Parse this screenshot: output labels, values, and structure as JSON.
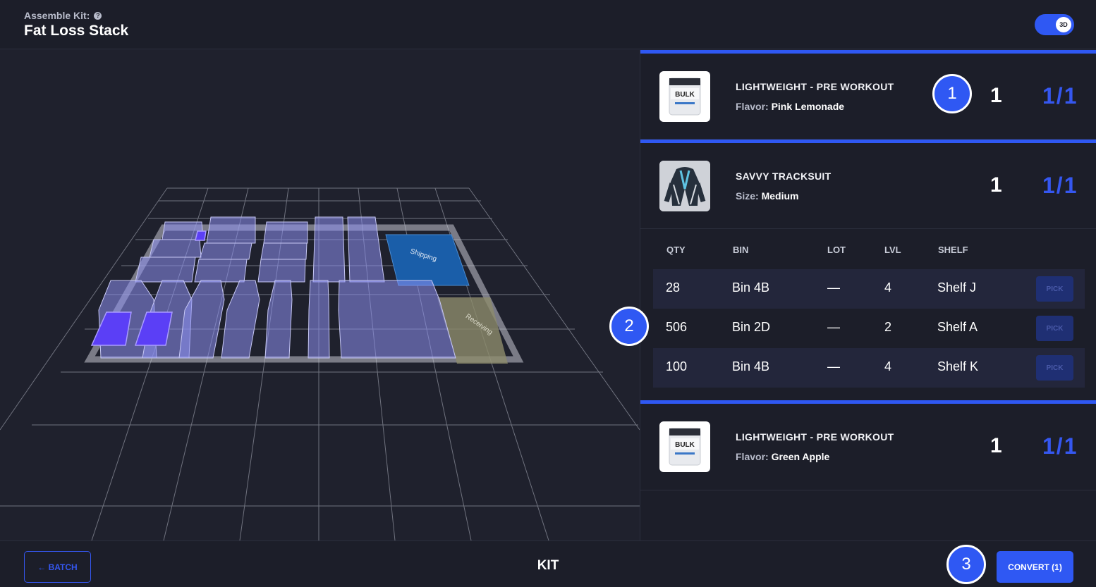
{
  "header": {
    "subtitle": "Assemble Kit:",
    "title": "Fat Loss Stack",
    "toggle_label": "3D"
  },
  "scene": {
    "zones": [
      "Shipping",
      "Receiving"
    ]
  },
  "items": [
    {
      "name": "LIGHTWEIGHT - PRE WORKOUT",
      "attr_key": "Flavor:",
      "attr_value": "Pink Lemonade",
      "qty": "1",
      "progress": "1/1",
      "thumb_label": "BULK"
    },
    {
      "name": "SAVVY TRACKSUIT",
      "attr_key": "Size:",
      "attr_value": "Medium",
      "qty": "1",
      "progress": "1/1"
    },
    {
      "name": "LIGHTWEIGHT - PRE WORKOUT",
      "attr_key": "Flavor:",
      "attr_value": "Green Apple",
      "qty": "1",
      "progress": "1/1",
      "thumb_label": "BULK"
    }
  ],
  "bin_table": {
    "headers": [
      "QTY",
      "BIN",
      "LOT",
      "LVL",
      "SHELF"
    ],
    "rows": [
      {
        "qty": "28",
        "bin": "Bin 4B",
        "lot": "—",
        "lvl": "4",
        "shelf": "Shelf J",
        "action": "PICK"
      },
      {
        "qty": "506",
        "bin": "Bin 2D",
        "lot": "—",
        "lvl": "2",
        "shelf": "Shelf A",
        "action": "PICK"
      },
      {
        "qty": "100",
        "bin": "Bin 4B",
        "lot": "—",
        "lvl": "4",
        "shelf": "Shelf K",
        "action": "PICK"
      }
    ]
  },
  "callouts": [
    "1",
    "2",
    "3"
  ],
  "footer": {
    "back_label": "BATCH",
    "center_label": "KIT",
    "convert_label": "CONVERT (1)"
  },
  "colors": {
    "accent": "#2f58f3",
    "background": "#1f212d",
    "panel": "#1c1e29"
  }
}
